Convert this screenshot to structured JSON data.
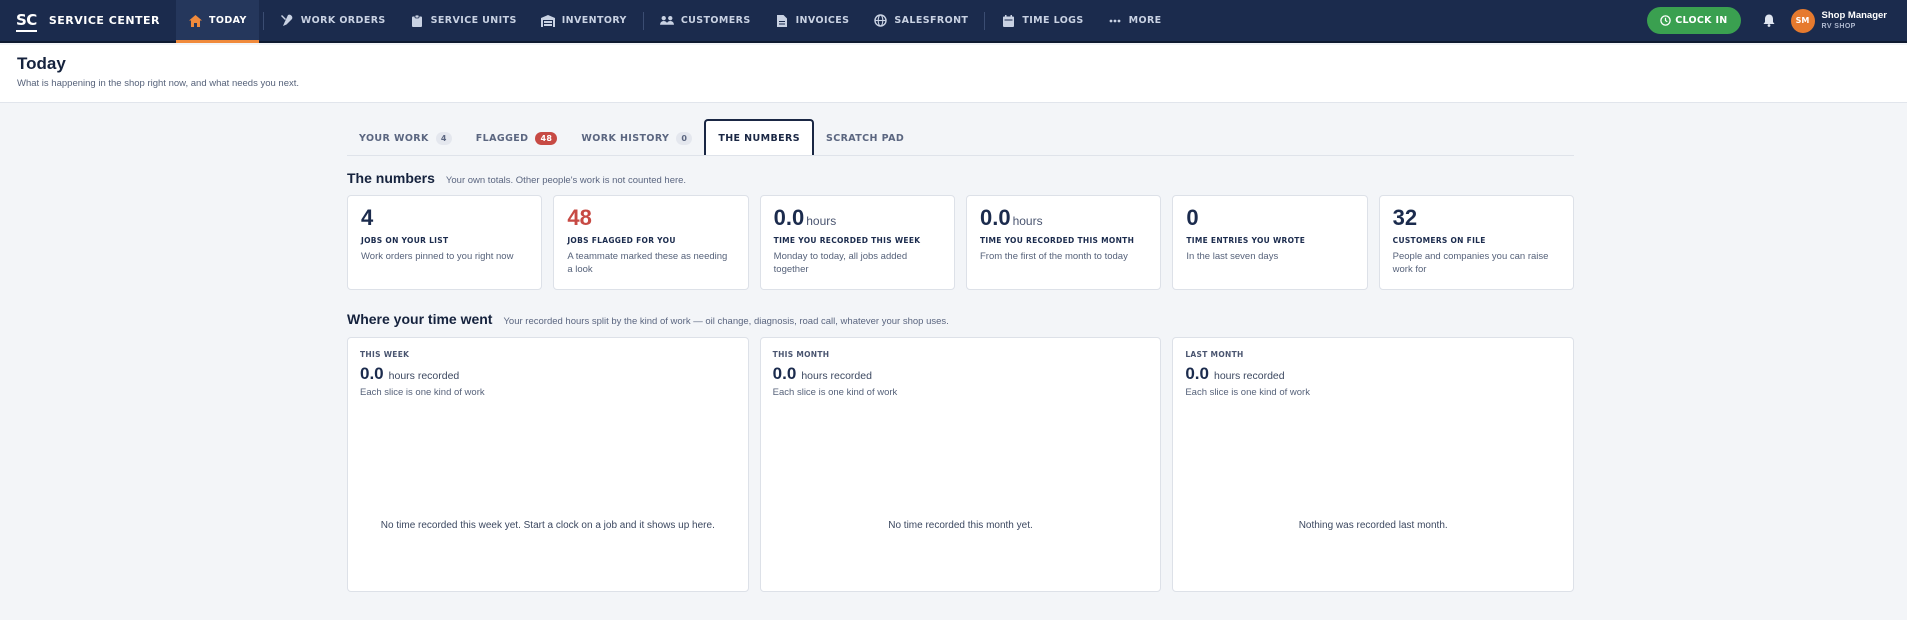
{
  "app": {
    "logo": "SC",
    "name": "SERVICE CENTER"
  },
  "nav": {
    "items": [
      {
        "label": "TODAY",
        "icon": "home-icon"
      },
      {
        "label": "WORK ORDERS",
        "icon": "wrench-icon"
      },
      {
        "label": "SERVICE UNITS",
        "icon": "clipboard-icon"
      },
      {
        "label": "INVENTORY",
        "icon": "warehouse-icon"
      },
      {
        "label": "CUSTOMERS",
        "icon": "users-icon"
      },
      {
        "label": "INVOICES",
        "icon": "document-icon"
      },
      {
        "label": "SALESFRONT",
        "icon": "globe-icon"
      },
      {
        "label": "TIME LOGS",
        "icon": "calendar-icon"
      },
      {
        "label": "MORE",
        "icon": "more-icon"
      }
    ],
    "clock_in": "CLOCK IN",
    "user": {
      "initials": "SM",
      "name": "Shop Manager",
      "shop": "RV SHOP"
    }
  },
  "page": {
    "title": "Today",
    "subtitle": "What is happening in the shop right now, and what needs you next."
  },
  "tabs": [
    {
      "label": "YOUR WORK",
      "count": "4"
    },
    {
      "label": "FLAGGED",
      "count": "48"
    },
    {
      "label": "WORK HISTORY",
      "count": "0"
    },
    {
      "label": "THE NUMBERS",
      "count": null
    },
    {
      "label": "SCRATCH PAD",
      "count": null
    }
  ],
  "numbers": {
    "title": "The numbers",
    "subtitle": "Your own totals. Other people's work is not counted here.",
    "cards": [
      {
        "value": "4",
        "unit": "",
        "label": "JOBS ON YOUR LIST",
        "desc": "Work orders pinned to you right now"
      },
      {
        "value": "48",
        "unit": "",
        "label": "JOBS FLAGGED FOR YOU",
        "desc": "A teammate marked these as needing a look"
      },
      {
        "value": "0.0",
        "unit": "hours",
        "label": "TIME YOU RECORDED THIS WEEK",
        "desc": "Monday to today, all jobs added together"
      },
      {
        "value": "0.0",
        "unit": "hours",
        "label": "TIME YOU RECORDED THIS MONTH",
        "desc": "From the first of the month to today"
      },
      {
        "value": "0",
        "unit": "",
        "label": "TIME ENTRIES YOU WROTE",
        "desc": "In the last seven days"
      },
      {
        "value": "32",
        "unit": "",
        "label": "CUSTOMERS ON FILE",
        "desc": "People and companies you can raise work for"
      }
    ]
  },
  "time": {
    "title": "Where your time went",
    "subtitle": "Your recorded hours split by the kind of work — oil change, diagnosis, road call, whatever your shop uses.",
    "panels": [
      {
        "period": "THIS WEEK",
        "hours": "0.0",
        "hours_label": "hours recorded",
        "note": "Each slice is one kind of work",
        "empty": "No time recorded this week yet. Start a clock on a job and it shows up here."
      },
      {
        "period": "THIS MONTH",
        "hours": "0.0",
        "hours_label": "hours recorded",
        "note": "Each slice is one kind of work",
        "empty": "No time recorded this month yet."
      },
      {
        "period": "LAST MONTH",
        "hours": "0.0",
        "hours_label": "hours recorded",
        "note": "Each slice is one kind of work",
        "empty": "Nothing was recorded last month."
      }
    ]
  },
  "colors": {
    "nav_bg": "#1b2b4d",
    "accent": "#f08a3c",
    "clock_in": "#3aa050",
    "flagged": "#c74a44"
  }
}
